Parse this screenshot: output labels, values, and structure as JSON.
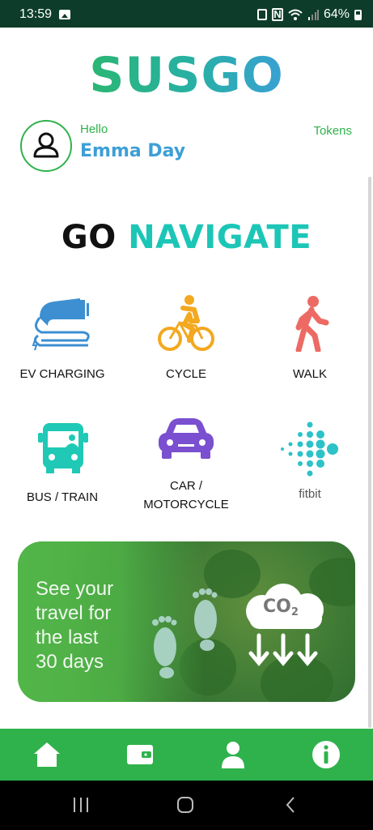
{
  "status_bar": {
    "time": "13:59",
    "battery": "64%"
  },
  "app": {
    "logo": "SUSGO"
  },
  "profile": {
    "greeting": "Hello",
    "name": "Emma Day",
    "tokens_label": "Tokens"
  },
  "heading": {
    "go": "GO",
    "navigate": "NAVIGATE"
  },
  "options": [
    {
      "label": "EV CHARGING",
      "icon": "ev-charging-icon"
    },
    {
      "label": "CYCLE",
      "icon": "cyclist-icon"
    },
    {
      "label": "WALK",
      "icon": "walking-person-icon"
    },
    {
      "label": "BUS / TRAIN",
      "icon": "bus-icon"
    },
    {
      "label": "CAR / MOTORCYCLE",
      "label_line1": "CAR /",
      "label_line2": "MOTORCYCLE",
      "icon": "car-icon"
    },
    {
      "label": "fitbit",
      "icon": "fitbit-logo-icon"
    }
  ],
  "banner": {
    "line1": "See your",
    "line2": "travel for",
    "line3": "the last",
    "line4": "30 days",
    "co2_label": "CO",
    "co2_sub": "2"
  },
  "bottom_nav": [
    "home-icon",
    "wallet-icon",
    "profile-icon",
    "info-icon"
  ],
  "colors": {
    "green": "#2fb24c",
    "teal": "#1cc6b6",
    "blue": "#3d9fd6",
    "dark_green": "#0d3d2a"
  }
}
